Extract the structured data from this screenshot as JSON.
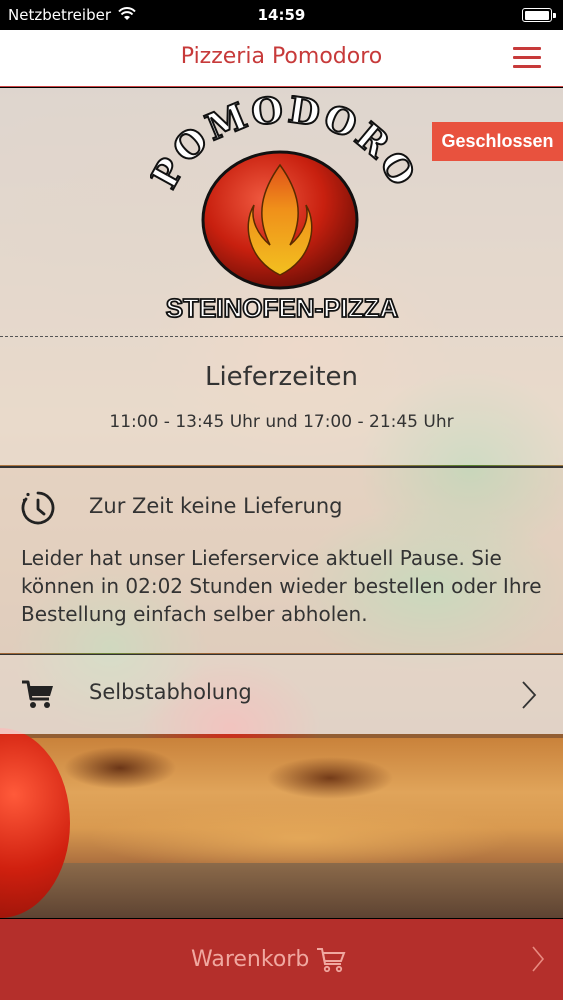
{
  "status_bar": {
    "carrier": "Netzbetreiber",
    "time": "14:59"
  },
  "navbar": {
    "title": "Pizzeria Pomodoro",
    "menu_icon": "hamburger-icon"
  },
  "badge": {
    "label": "Geschlossen",
    "color": "#e8523e"
  },
  "logo": {
    "top_text": "POMODORO",
    "bottom_text": "STEINOFEN-PIZZA"
  },
  "delivery_times": {
    "title": "Lieferzeiten",
    "hours": "11:00 - 13:45 Uhr und 17:00 - 21:45 Uhr"
  },
  "no_delivery": {
    "icon": "clock-icon",
    "title": "Zur Zeit keine Lieferung",
    "message": "Leider hat unser Lieferservice aktuell Pause. Sie können in 02:02 Stunden wieder bestellen oder Ihre Bestellung einfach selber abholen."
  },
  "pickup": {
    "icon": "cart-icon",
    "label": "Selbstabholung"
  },
  "cart_bar": {
    "label": "Warenkorb",
    "color": "#be322d"
  }
}
